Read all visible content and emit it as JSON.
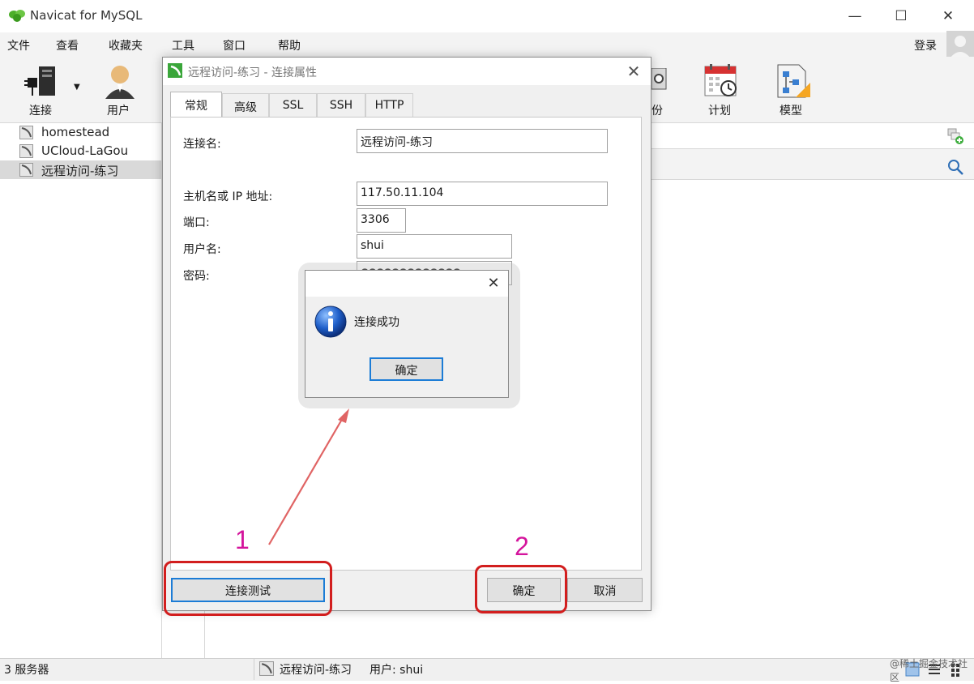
{
  "app": {
    "title": "Navicat for MySQL"
  },
  "window_controls": {
    "minimize": "—",
    "maximize": "☐",
    "close": "✕"
  },
  "menu": {
    "items": [
      "文件",
      "查看",
      "收藏夹",
      "工具",
      "窗口",
      "帮助"
    ],
    "login": "登录"
  },
  "toolbar": {
    "connect_label": "连接",
    "user_label": "用户",
    "backup_label_partial": "份",
    "schedule_label": "计划",
    "model_label": "模型"
  },
  "connections": [
    "homestead",
    "UCloud-LaGou",
    "远程访问-练习"
  ],
  "dialog": {
    "title": "远程访问-练习 - 连接属性",
    "tabs": [
      "常规",
      "高级",
      "SSL",
      "SSH",
      "HTTP"
    ],
    "fields": {
      "connection_name_label": "连接名:",
      "connection_name_value": "远程访问-练习",
      "host_label": "主机名或 IP 地址:",
      "host_value": "117.50.11.104",
      "port_label": "端口:",
      "port_value": "3306",
      "username_label": "用户名:",
      "username_value": "shui",
      "password_label": "密码:",
      "password_value": "●●●●●●●●●●●●●"
    },
    "test_button": "连接测试",
    "ok_button": "确定",
    "cancel_button": "取消"
  },
  "message_box": {
    "text": "连接成功",
    "ok_button": "确定"
  },
  "status_bar": {
    "servers": "3 服务器",
    "current_connection": "远程访问-练习",
    "user": "用户: shui"
  },
  "annotations": {
    "step1": "1",
    "step2": "2"
  },
  "watermark": "@稀土掘金技术社区",
  "colors": {
    "annotation_box": "#d21e1e",
    "annotation_number": "#d4149c",
    "focus_blue": "#1c7cd6"
  }
}
